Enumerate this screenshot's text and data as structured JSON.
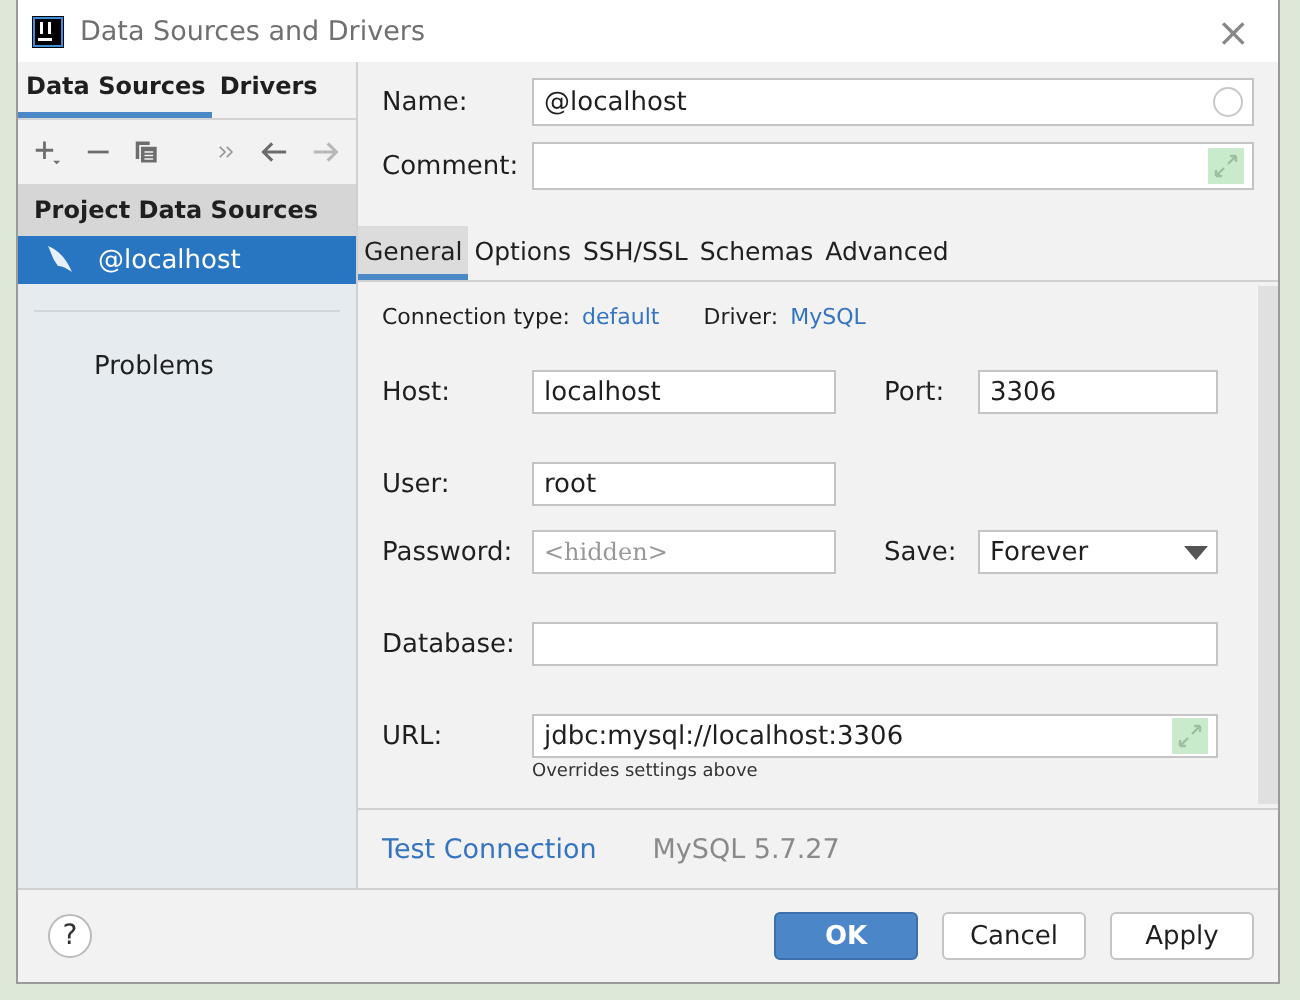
{
  "window": {
    "title": "Data Sources and Drivers",
    "close": "×"
  },
  "sidebar": {
    "tabs": [
      {
        "label": "Data Sources",
        "selected": true
      },
      {
        "label": "Drivers",
        "selected": false
      }
    ],
    "toolbar": [
      {
        "kind": "add",
        "disabled": false
      },
      {
        "kind": "remove",
        "disabled": false
      },
      {
        "kind": "copy",
        "disabled": false
      },
      {
        "kind": "more",
        "disabled": false
      },
      {
        "kind": "back",
        "disabled": false
      },
      {
        "kind": "forward",
        "disabled": true
      }
    ],
    "section": "Project Data Sources",
    "items": [
      {
        "label": "@localhost",
        "selected": true
      }
    ],
    "problems": "Problems"
  },
  "name": {
    "label": "Name:",
    "value": "@localhost"
  },
  "comment": {
    "label": "Comment:"
  },
  "tabs": [
    {
      "label": "General",
      "selected": true
    },
    {
      "label": "Options",
      "selected": false
    },
    {
      "label": "SSH/SSL",
      "selected": false
    },
    {
      "label": "Schemas",
      "selected": false
    },
    {
      "label": "Advanced",
      "selected": false
    }
  ],
  "connection": {
    "type_label": "Connection type:",
    "type": "default",
    "driver_label": "Driver:",
    "driver": "MySQL"
  },
  "host": {
    "label": "Host:",
    "value": "localhost"
  },
  "port": {
    "label": "Port:",
    "value": "3306"
  },
  "user": {
    "label": "User:",
    "value": "root"
  },
  "password": {
    "label": "Password:",
    "placeholder": "<hidden>"
  },
  "save": {
    "label": "Save:",
    "value": "Forever"
  },
  "database": {
    "label": "Database:"
  },
  "url": {
    "label": "URL:",
    "value": "jdbc:mysql://localhost:3306",
    "hint": "Overrides settings above"
  },
  "test_connection": "Test Connection",
  "server_version": "MySQL 5.7.27",
  "help": "?",
  "buttons": [
    {
      "label": "OK",
      "primary": true
    },
    {
      "label": "Cancel",
      "primary": false
    },
    {
      "label": "Apply",
      "primary": false
    }
  ]
}
